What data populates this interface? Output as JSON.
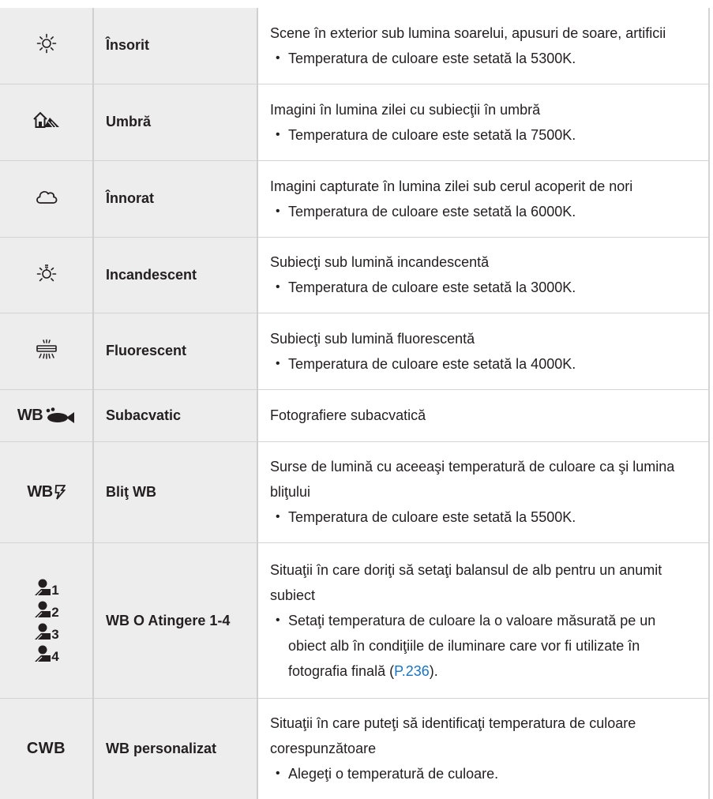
{
  "rows": [
    {
      "icon": "sun-icon",
      "name": "Însorit",
      "desc": "Scene în exterior sub lumina soarelui, apusuri de soare, artificii",
      "bullet": "Temperatura de culoare este setată la 5300K."
    },
    {
      "icon": "shade-icon",
      "name": "Umbră",
      "desc": "Imagini în lumina zilei cu subiecţii în umbră",
      "bullet": "Temperatura de culoare este setată la 7500K."
    },
    {
      "icon": "cloud-icon",
      "name": "Înnorat",
      "desc": "Imagini capturate în lumina zilei sub cerul acoperit de nori",
      "bullet": "Temperatura de culoare este setată la 6000K."
    },
    {
      "icon": "incandescent-bulb-icon",
      "name": "Incandescent",
      "desc": "Subiecţi sub lumină incandescentă",
      "bullet": "Temperatura de culoare este setată la 3000K."
    },
    {
      "icon": "fluorescent-light-icon",
      "name": "Fluorescent",
      "desc": "Subiecţi sub lumină fluorescentă",
      "bullet": "Temperatura de culoare este setată la 4000K."
    },
    {
      "icon": "underwater-fish-icon",
      "icon_text": "WB",
      "name": "Subacvatic",
      "desc": "Fotografiere subacvatică"
    },
    {
      "icon": "flash-wb-icon",
      "icon_text": "WB",
      "name": "Bliţ WB",
      "desc": "Surse de lumină cu aceeaşi temperatură de culoare ca şi lumina bliţului",
      "bullet": "Temperatura de culoare este setată la 5500K."
    },
    {
      "icon": "one-touch-wb-icon",
      "touch_numbers": [
        "1",
        "2",
        "3",
        "4"
      ],
      "name": "WB O Atingere 1-4",
      "desc": "Situaţii în care doriţi să setaţi balansul de alb pentru un anumit subiect",
      "bullet_before": "Setaţi temperatura de culoare la o valoare măsurată pe un obiect alb în condiţiile de iluminare care vor fi utilizate în fotografia finală (",
      "bullet_link": "P.236",
      "bullet_after": ")."
    },
    {
      "icon": "custom-wb-icon",
      "icon_text": "CWB",
      "name": "WB personalizat",
      "desc": "Situaţii în care puteţi să identificaţi temperatura de culoare corespunzătoare",
      "bullet": "Alegeţi o temperatură de culoare."
    }
  ]
}
